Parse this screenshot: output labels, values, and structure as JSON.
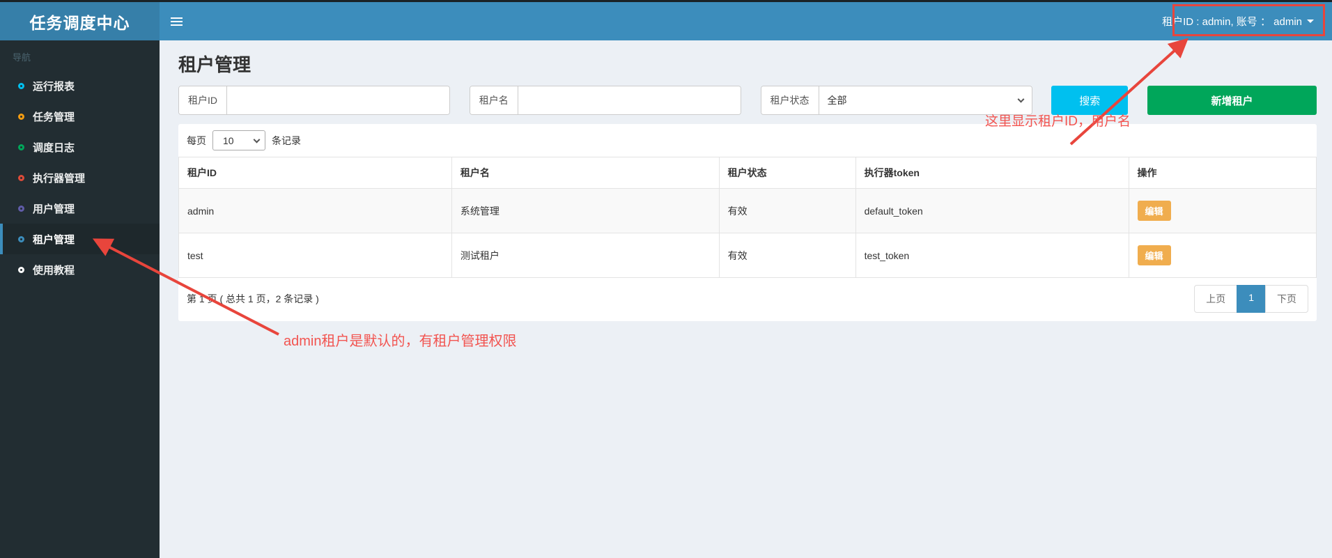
{
  "header": {
    "logo": "任务调度中心",
    "user_info": "租户ID : admin, 账号 ： admin"
  },
  "sidebar": {
    "section_label": "导航",
    "items": [
      {
        "label": "运行报表",
        "color": "#00c0ef",
        "active": false
      },
      {
        "label": "任务管理",
        "color": "#f39c12",
        "active": false
      },
      {
        "label": "调度日志",
        "color": "#00a65a",
        "active": false
      },
      {
        "label": "执行器管理",
        "color": "#dd4b39",
        "active": false
      },
      {
        "label": "用户管理",
        "color": "#605ca8",
        "active": false
      },
      {
        "label": "租户管理",
        "color": "#3c8dbc",
        "active": true
      },
      {
        "label": "使用教程",
        "color": "#ffffff",
        "active": false
      }
    ]
  },
  "main": {
    "page_title": "租户管理",
    "filters": {
      "tenant_id": {
        "label": "租户ID",
        "value": ""
      },
      "tenant_name": {
        "label": "租户名",
        "value": ""
      },
      "tenant_status": {
        "label": "租户状态",
        "selected": "全部"
      }
    },
    "search_button": "搜索",
    "add_button": "新增租户",
    "page_size": {
      "prefix": "每页",
      "selected": "10",
      "suffix": "条记录"
    },
    "table": {
      "columns": [
        "租户ID",
        "租户名",
        "租户状态",
        "执行器token",
        "操作"
      ],
      "rows": [
        {
          "tenant_id": "admin",
          "tenant_name": "系统管理",
          "status": "有效",
          "token": "default_token",
          "action": "编辑"
        },
        {
          "tenant_id": "test",
          "tenant_name": "测试租户",
          "status": "有效",
          "token": "test_token",
          "action": "编辑"
        }
      ]
    },
    "pagination": {
      "summary": "第 1 页 ( 总共 1 页，2 条记录 )",
      "prev": "上页",
      "current": "1",
      "next": "下页"
    }
  },
  "annotations": {
    "color": "#e8453c",
    "text_color": "#f25450",
    "top_note": "这里显示租户ID，用户名",
    "bottom_note": "admin租户是默认的，有租户管理权限"
  },
  "colors": {
    "navbar": "#3c8dbc",
    "logo_bg": "#367fa9",
    "sidebar_bg": "#222d32",
    "search_btn": "#00c0ef",
    "add_btn": "#00a65a",
    "edit_btn": "#f0ad4e",
    "pagination_active": "#3c8dbc"
  }
}
